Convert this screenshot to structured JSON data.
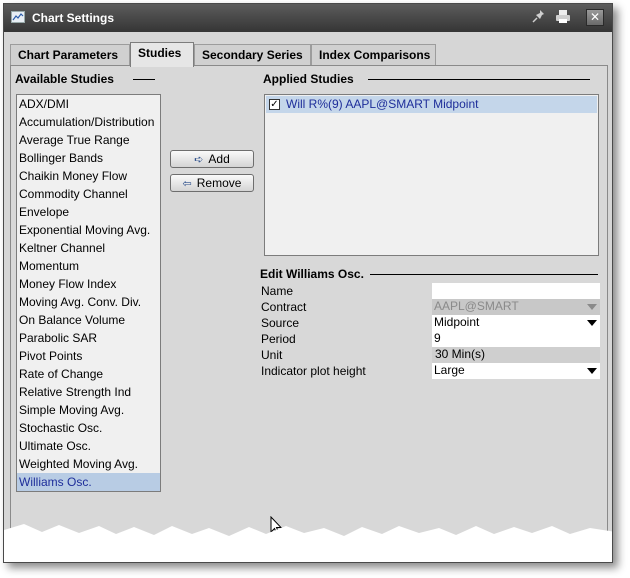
{
  "window": {
    "title": "Chart Settings"
  },
  "tabs": [
    {
      "label": "Chart Parameters"
    },
    {
      "label": "Studies"
    },
    {
      "label": "Secondary Series"
    },
    {
      "label": "Index Comparisons"
    }
  ],
  "active_tab": "Studies",
  "available_studies": {
    "title": "Available Studies",
    "items": [
      "ADX/DMI",
      "Accumulation/Distribution",
      "Average True Range",
      "Bollinger Bands",
      "Chaikin Money Flow",
      "Commodity Channel",
      "Envelope",
      "Exponential Moving Avg.",
      "Keltner Channel",
      "Momentum",
      "Money Flow Index",
      "Moving Avg. Conv. Div.",
      "On Balance Volume",
      "Parabolic SAR",
      "Pivot Points",
      "Rate of Change",
      "Relative Strength Ind",
      "Simple Moving Avg.",
      "Stochastic Osc.",
      "Ultimate Osc.",
      "Weighted Moving Avg.",
      "Williams Osc."
    ],
    "selected": "Williams Osc."
  },
  "buttons": {
    "add": "Add",
    "remove": "Remove"
  },
  "applied_studies": {
    "title": "Applied Studies",
    "items": [
      {
        "label": "Will R%(9) AAPL@SMART Midpoint",
        "checked": true
      }
    ]
  },
  "edit": {
    "title": "Edit Williams Osc.",
    "fields": {
      "name": {
        "label": "Name",
        "value": ""
      },
      "contract": {
        "label": "Contract",
        "value": "AAPL@SMART"
      },
      "source": {
        "label": "Source",
        "value": "Midpoint"
      },
      "period": {
        "label": "Period",
        "value": "9"
      },
      "unit": {
        "label": "Unit",
        "value": "30 Min(s)"
      },
      "plot_height": {
        "label": "Indicator plot height",
        "value": "Large"
      }
    }
  },
  "colors": {
    "selection": "#b8cce4",
    "selection_text": "#1e2e9a",
    "titlebar": "#454545"
  }
}
